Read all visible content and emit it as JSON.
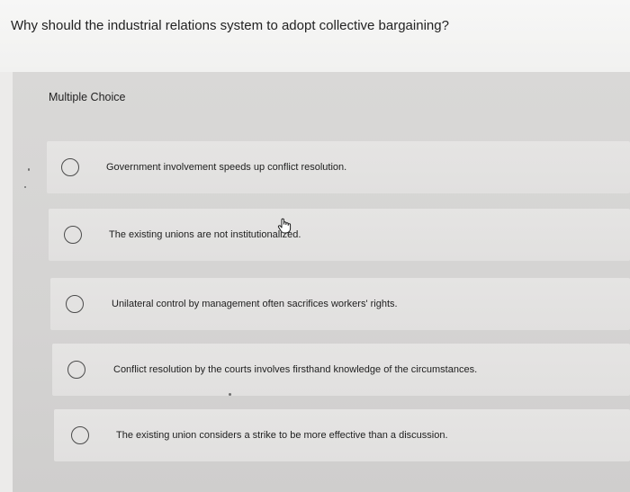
{
  "question": {
    "text": "Why should the industrial relations system to adopt collective bargaining?"
  },
  "quiz": {
    "type_label": "Multiple Choice",
    "options": [
      {
        "label": "Government involvement speeds up conflict resolution."
      },
      {
        "label": "The existing unions are not institutionalized."
      },
      {
        "label": "Unilateral control by management often sacrifices workers' rights."
      },
      {
        "label": "Conflict resolution by the courts involves firsthand knowledge of the circumstances."
      },
      {
        "label": "The existing union considers a strike to be more effective than a discussion."
      }
    ]
  },
  "icons": {
    "radio": "radio-unselected-icon",
    "cursor": "hand-pointer-icon"
  },
  "colors": {
    "page_background": "#ecebea",
    "card_background": "#d6d5d4",
    "option_background": "#e3e2e1",
    "radio_border": "#4b4b4b"
  }
}
